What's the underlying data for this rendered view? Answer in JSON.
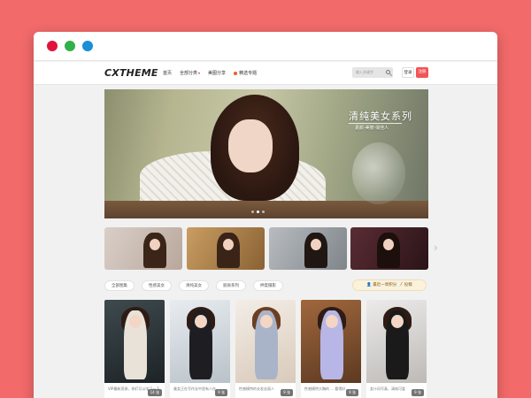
{
  "site": {
    "logo": "CXTHEME",
    "nav": [
      {
        "label": "首页"
      },
      {
        "label": "全部分类",
        "caret": "▾"
      },
      {
        "label": "美图分享"
      },
      {
        "label": "精选专题"
      }
    ],
    "search_placeholder": "输入关键字",
    "login": "登录",
    "register": "注册",
    "accent": "#f25555"
  },
  "banner": {
    "title": "清纯美女系列",
    "subtitle": "素颜·美丽·俏佳人"
  },
  "tags": [
    "全部图集",
    "性感美女",
    "清纯美女",
    "丽质系列",
    "绅度摄影"
  ],
  "notice": "👤 最近一周积分 📝 投稿",
  "cards": [
    {
      "badge": "14 张",
      "caption": "VIP最新资源，你们可以学习一下"
    },
    {
      "badge": "9 张",
      "caption": "美女正在写作业中里有人在"
    },
    {
      "badge": "9 张",
      "caption": "性感模特的长发丝丽人"
    },
    {
      "badge": "9 张",
      "caption": "性感模特大胸的 ... 看得好"
    },
    {
      "badge": "9 张",
      "caption": "女仆风写真，清纯可爱"
    }
  ]
}
